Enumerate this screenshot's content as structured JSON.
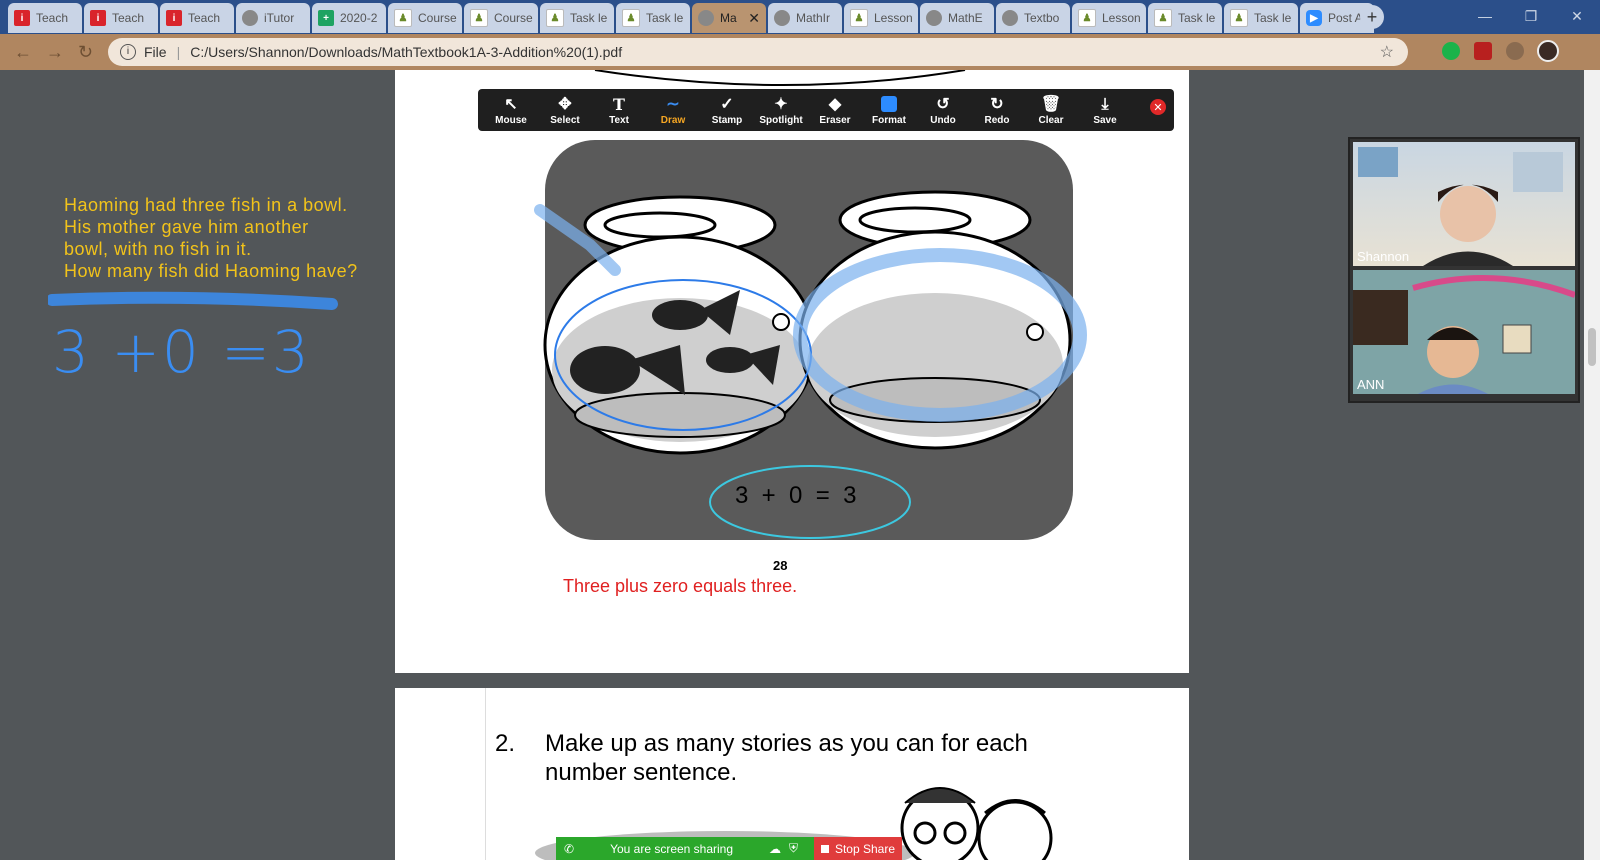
{
  "browser": {
    "tabs": [
      {
        "label": "Teach",
        "icon": "red-i-icon"
      },
      {
        "label": "Teach",
        "icon": "red-i-icon"
      },
      {
        "label": "Teach",
        "icon": "red-i-icon"
      },
      {
        "label": "iTutor",
        "icon": "globe-icon"
      },
      {
        "label": "2020-2",
        "icon": "sheets-icon"
      },
      {
        "label": "Course",
        "icon": "doc-icon"
      },
      {
        "label": "Course",
        "icon": "doc-icon"
      },
      {
        "label": "Task le",
        "icon": "doc-icon"
      },
      {
        "label": "Task le",
        "icon": "doc-icon"
      },
      {
        "label": "Ma",
        "icon": "globe-icon",
        "active": true
      },
      {
        "label": "MathIr",
        "icon": "globe-icon"
      },
      {
        "label": "Lesson",
        "icon": "doc-icon"
      },
      {
        "label": "MathE",
        "icon": "globe-icon"
      },
      {
        "label": "Textbo",
        "icon": "globe-icon"
      },
      {
        "label": "Lesson",
        "icon": "doc-icon"
      },
      {
        "label": "Task le",
        "icon": "doc-icon"
      },
      {
        "label": "Task le",
        "icon": "doc-icon"
      },
      {
        "label": "Post A",
        "icon": "zoom-icon"
      }
    ],
    "address": {
      "scheme_label": "File",
      "url": "C:/Users/Shannon/Downloads/MathTextbook1A-3-Addition%20(1).pdf"
    }
  },
  "annotation_toolbar": {
    "tools": [
      "Mouse",
      "Select",
      "Text",
      "Draw",
      "Stamp",
      "Spotlight",
      "Eraser",
      "Format",
      "Undo",
      "Redo",
      "Clear",
      "Save"
    ],
    "selected": "Draw"
  },
  "whiteboard": {
    "story": "Haoming had three fish in a bowl.\nHis mother gave him another\nbowl, with no fish in it.\nHow many fish did Haoming have?",
    "handwritten_equation": "3 +0 =3",
    "story_color": "#f2c31a",
    "ink_color": "#3a8df2"
  },
  "pdf": {
    "equation": "3  +  0  =  3",
    "page_number": "28",
    "typed_note": "Three plus zero equals three.",
    "question_number": "2.",
    "question_text_line1": "Make up as many stories as you can for each",
    "question_text_line2": "number sentence."
  },
  "video": {
    "participants": [
      {
        "name": "Shannon"
      },
      {
        "name": "ANN"
      }
    ]
  },
  "share_bar": {
    "status": "You are screen sharing",
    "stop_label": "Stop Share"
  }
}
